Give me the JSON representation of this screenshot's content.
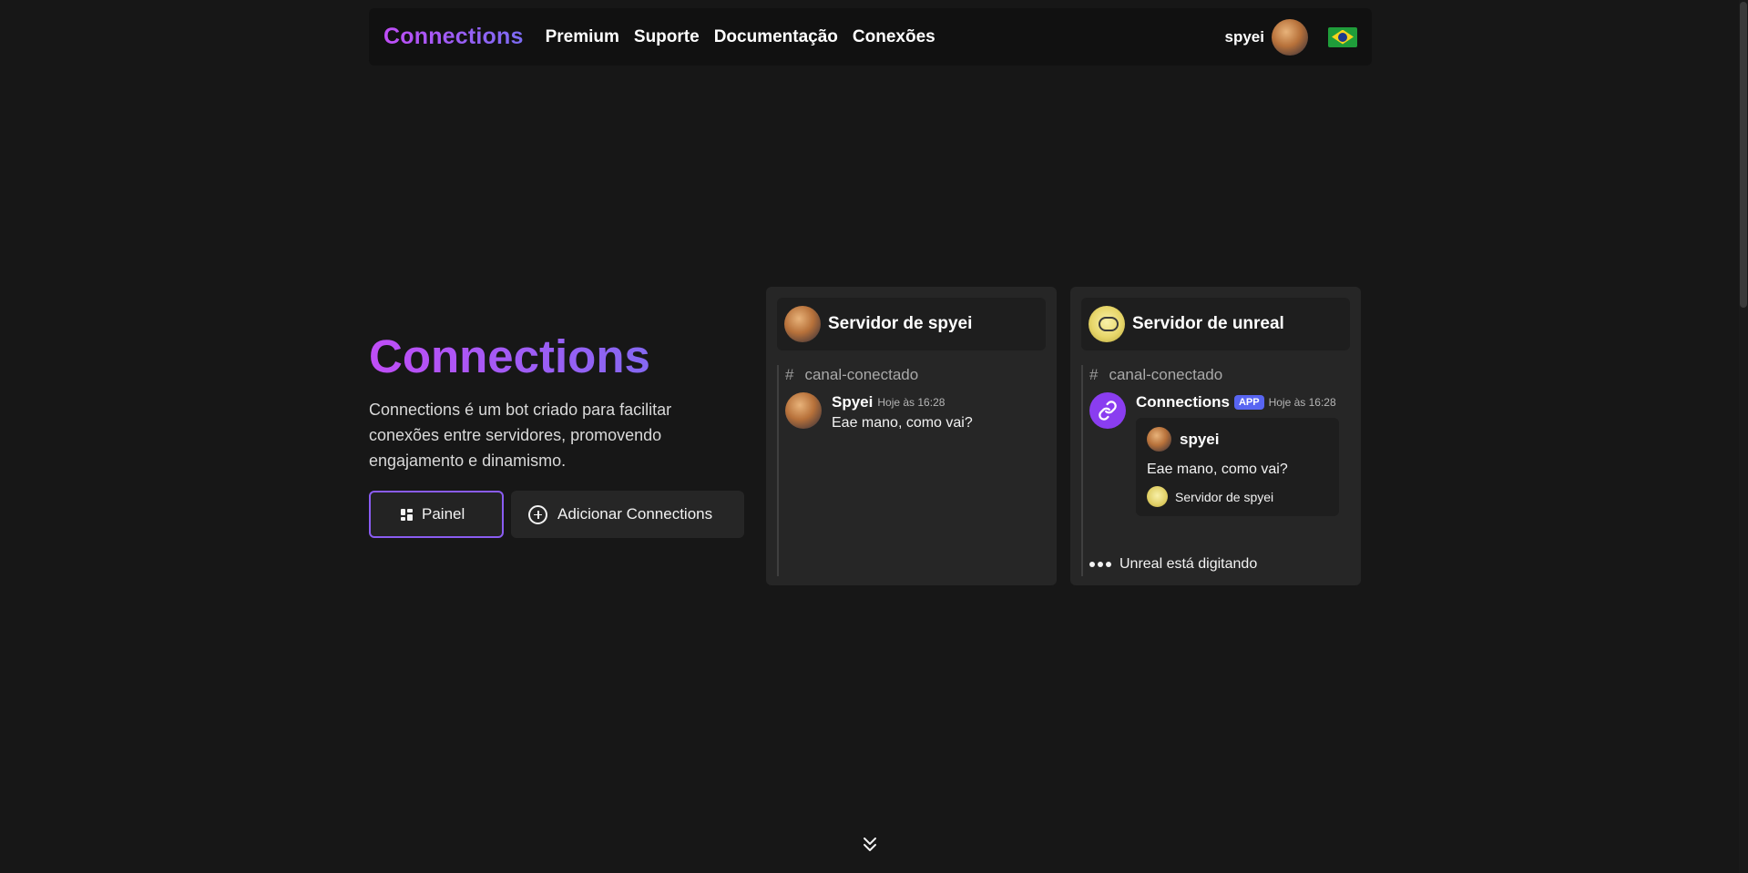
{
  "navbar": {
    "brand": "Connections",
    "links": [
      "Premium",
      "Suporte",
      "Documentação",
      "Conexões"
    ],
    "username": "spyei",
    "language_flag": "brazil-flag-icon"
  },
  "hero": {
    "title": "Connections",
    "description": "Connections é um bot criado para facilitar conexões entre servidores, promovendo engajamento e dinamismo.",
    "buttons": {
      "painel": "Painel",
      "add": "Adicionar Connections"
    }
  },
  "cards": [
    {
      "server_name": "Servidor de spyei",
      "channel": "canal-conectado",
      "message": {
        "author": "Spyei",
        "time": "Hoje às 16:28",
        "text": "Eae mano, como vai?"
      }
    },
    {
      "server_name": "Servidor de unreal",
      "channel": "canal-conectado",
      "message": {
        "author": "Connections",
        "badge": "APP",
        "time": "Hoje às 16:28",
        "embed": {
          "author": "spyei",
          "text": "Eae mano, como vai?",
          "footer": "Servidor de spyei"
        }
      },
      "typing": "Unreal está digitando"
    }
  ],
  "colors": {
    "background": "#171717",
    "navbar": "#111111",
    "card": "#262626",
    "accent_start": "#c04df7",
    "accent_end": "#6f72f0",
    "app_badge": "#5865f2",
    "bot_avatar": "#8a3df0"
  }
}
